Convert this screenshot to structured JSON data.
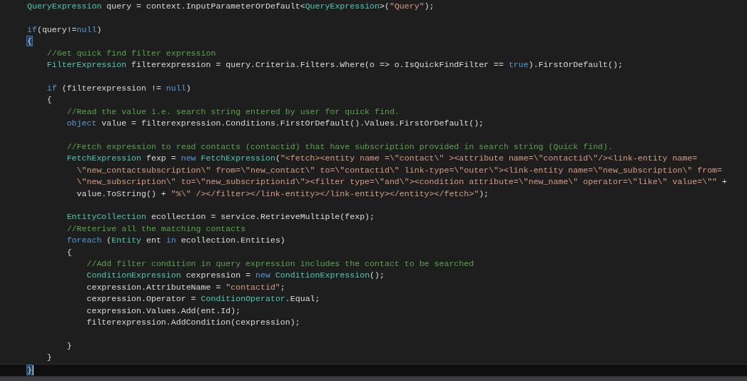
{
  "editor": {
    "lines": [
      {
        "kind": "code",
        "tokens": [
          {
            "kind": "type",
            "text": "QueryExpression"
          },
          {
            "kind": "plain",
            "text": " query = context.InputParameterOrDefault<"
          },
          {
            "kind": "type",
            "text": "QueryExpression"
          },
          {
            "kind": "plain",
            "text": ">("
          },
          {
            "kind": "string",
            "text": "\"Query\""
          },
          {
            "kind": "plain",
            "text": ");"
          }
        ]
      },
      {
        "kind": "blank"
      },
      {
        "kind": "code",
        "tokens": [
          {
            "kind": "keyword",
            "text": "if"
          },
          {
            "kind": "plain",
            "text": "(query!="
          },
          {
            "kind": "keyword",
            "text": "null"
          },
          {
            "kind": "plain",
            "text": ")"
          }
        ]
      },
      {
        "kind": "code",
        "tokens": [
          {
            "kind": "plain",
            "text": "{",
            "highlighted": true
          }
        ]
      },
      {
        "kind": "code",
        "tokens": [
          {
            "kind": "comment",
            "text": "    //Get quick find filter expression"
          }
        ]
      },
      {
        "kind": "code",
        "tokens": [
          {
            "kind": "type",
            "text": "    FilterExpression"
          },
          {
            "kind": "plain",
            "text": " filterexpression = query.Criteria.Filters.Where(o => o.IsQuickFindFilter == "
          },
          {
            "kind": "keyword",
            "text": "true"
          },
          {
            "kind": "plain",
            "text": ").FirstOrDefault();"
          }
        ]
      },
      {
        "kind": "blank"
      },
      {
        "kind": "code",
        "tokens": [
          {
            "kind": "keyword",
            "text": "    if"
          },
          {
            "kind": "plain",
            "text": " (filterexpression != "
          },
          {
            "kind": "keyword",
            "text": "null"
          },
          {
            "kind": "plain",
            "text": ")"
          }
        ]
      },
      {
        "kind": "code",
        "tokens": [
          {
            "kind": "plain",
            "text": "    {"
          }
        ]
      },
      {
        "kind": "code",
        "tokens": [
          {
            "kind": "comment",
            "text": "        //Read the value i.e. search string entered by user for quick find."
          }
        ]
      },
      {
        "kind": "code",
        "tokens": [
          {
            "kind": "keyword",
            "text": "        object"
          },
          {
            "kind": "plain",
            "text": " value = filterexpression.Conditions.FirstOrDefault().Values.FirstOrDefault();"
          }
        ]
      },
      {
        "kind": "blank"
      },
      {
        "kind": "code",
        "tokens": [
          {
            "kind": "comment",
            "text": "        //Fetch expression to read contacts (contactid) that have subscription provided in search string (Quick find)."
          }
        ]
      },
      {
        "kind": "code",
        "tokens": [
          {
            "kind": "type",
            "text": "        FetchExpression"
          },
          {
            "kind": "plain",
            "text": " fexp = "
          },
          {
            "kind": "keyword",
            "text": "new"
          },
          {
            "kind": "type",
            "text": " FetchExpression"
          },
          {
            "kind": "plain",
            "text": "("
          },
          {
            "kind": "string",
            "text": "\"<fetch><entity name =\\\"contact\\\" ><attribute name=\\\"contactid\\\"/><link-entity name="
          }
        ]
      },
      {
        "kind": "code",
        "tokens": [
          {
            "kind": "string",
            "text": "          \\\"new_contactsubscription\\\" from=\\\"new_contact\\\" to=\\\"contactid\\\" link-type=\\\"outer\\\"><link-entity name=\\\"new_subscription\\\" from="
          }
        ]
      },
      {
        "kind": "code",
        "tokens": [
          {
            "kind": "string",
            "text": "          \\\"new_subscription\\\" to=\\\"new_subscriptionid\\\"><filter type=\\\"and\\\"><condition attribute=\\\"new_name\\\" operator=\\\"like\\\" value=\\\"\""
          },
          {
            "kind": "plain",
            "text": " +"
          }
        ]
      },
      {
        "kind": "code",
        "tokens": [
          {
            "kind": "plain",
            "text": "          value.ToString() + "
          },
          {
            "kind": "string",
            "text": "\"%\\\" /></filter></link-entity></link-entity></entity></fetch>\""
          },
          {
            "kind": "plain",
            "text": ");"
          }
        ]
      },
      {
        "kind": "blank"
      },
      {
        "kind": "code",
        "tokens": [
          {
            "kind": "type",
            "text": "        EntityCollection"
          },
          {
            "kind": "plain",
            "text": " ecollection = service.RetrieveMultiple(fexp);"
          }
        ]
      },
      {
        "kind": "code",
        "tokens": [
          {
            "kind": "comment",
            "text": "        //Reterive all the matching contacts"
          }
        ]
      },
      {
        "kind": "code",
        "tokens": [
          {
            "kind": "keyword",
            "text": "        foreach"
          },
          {
            "kind": "plain",
            "text": " ("
          },
          {
            "kind": "type",
            "text": "Entity"
          },
          {
            "kind": "plain",
            "text": " ent "
          },
          {
            "kind": "keyword",
            "text": "in"
          },
          {
            "kind": "plain",
            "text": " ecollection.Entities)"
          }
        ]
      },
      {
        "kind": "code",
        "tokens": [
          {
            "kind": "plain",
            "text": "        {"
          }
        ]
      },
      {
        "kind": "code",
        "tokens": [
          {
            "kind": "comment",
            "text": "            //Add filter condition in query expression includes the contact to be searched"
          }
        ]
      },
      {
        "kind": "code",
        "tokens": [
          {
            "kind": "type",
            "text": "            ConditionExpression"
          },
          {
            "kind": "plain",
            "text": " cexpression = "
          },
          {
            "kind": "keyword",
            "text": "new"
          },
          {
            "kind": "type",
            "text": " ConditionExpression"
          },
          {
            "kind": "plain",
            "text": "();"
          }
        ]
      },
      {
        "kind": "code",
        "tokens": [
          {
            "kind": "plain",
            "text": "            cexpression.AttributeName = "
          },
          {
            "kind": "string",
            "text": "\"contactid\""
          },
          {
            "kind": "plain",
            "text": ";"
          }
        ]
      },
      {
        "kind": "code",
        "tokens": [
          {
            "kind": "plain",
            "text": "            cexpression.Operator = "
          },
          {
            "kind": "type",
            "text": "ConditionOperator"
          },
          {
            "kind": "plain",
            "text": ".Equal;"
          }
        ]
      },
      {
        "kind": "code",
        "tokens": [
          {
            "kind": "plain",
            "text": "            cexpression.Values.Add(ent.Id);"
          }
        ]
      },
      {
        "kind": "code",
        "tokens": [
          {
            "kind": "plain",
            "text": "            filterexpression.AddCondition(cexpression);"
          }
        ]
      },
      {
        "kind": "blank"
      },
      {
        "kind": "code",
        "tokens": [
          {
            "kind": "plain",
            "text": "        }"
          }
        ]
      },
      {
        "kind": "code",
        "tokens": [
          {
            "kind": "plain",
            "text": "    }"
          }
        ]
      },
      {
        "kind": "code",
        "current": true,
        "tokens": [
          {
            "kind": "plain",
            "text": "}",
            "highlighted": true
          }
        ]
      }
    ]
  }
}
